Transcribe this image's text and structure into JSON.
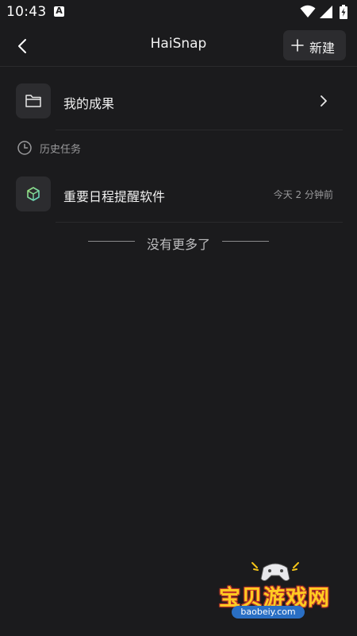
{
  "status_bar": {
    "time": "10:43",
    "notification_icon": "a-badge-icon",
    "icons": [
      "wifi-icon",
      "signal-icon",
      "battery-charging-icon"
    ]
  },
  "header": {
    "title": "HaiSnap",
    "new_button_label": "新建"
  },
  "results_row": {
    "label": "我的成果"
  },
  "history": {
    "section_label": "历史任务",
    "items": [
      {
        "title": "重要日程提醒软件",
        "time": "今天 2 分钟前"
      }
    ]
  },
  "end_message": "没有更多了",
  "watermark": {
    "title": "宝贝游戏网",
    "url": "baobeiy.com"
  },
  "colors": {
    "background": "#1b1b1d",
    "surface": "#2c2c2f",
    "text_primary": "#f0f0f0",
    "text_secondary": "#9a9a9c"
  }
}
